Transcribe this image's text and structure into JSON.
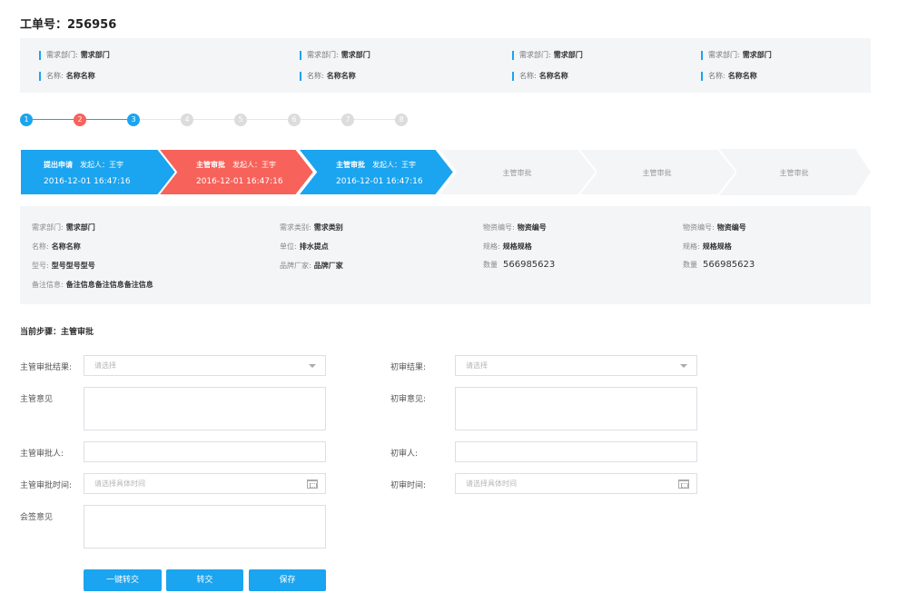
{
  "header": {
    "order_no": "工单号：256956"
  },
  "summary": [
    {
      "label": "需求部门:",
      "value": "需求部门"
    },
    {
      "label": "需求部门:",
      "value": "需求部门"
    },
    {
      "label": "需求部门:",
      "value": "需求部门"
    },
    {
      "label": "需求部门:",
      "value": "需求部门"
    },
    {
      "label": "名称:",
      "value": "名称名称"
    },
    {
      "label": "名称:",
      "value": "名称名称"
    },
    {
      "label": "名称:",
      "value": "名称名称"
    },
    {
      "label": "名称:",
      "value": "名称名称"
    }
  ],
  "stepper": {
    "steps": [
      {
        "label": "1",
        "state": "done"
      },
      {
        "label": "2",
        "state": "rejected"
      },
      {
        "label": "3",
        "state": "current"
      },
      {
        "label": "4",
        "state": "pending"
      },
      {
        "label": "5",
        "state": "pending"
      },
      {
        "label": "6",
        "state": "pending"
      },
      {
        "label": "7",
        "state": "pending"
      },
      {
        "label": "8",
        "state": "pending"
      }
    ],
    "colors": {
      "done": "#1ba4ef",
      "rejected": "#f7625b",
      "pending": "#dcdcdc"
    }
  },
  "flow": [
    {
      "title": "提出申请",
      "starter": "发起人：王宇",
      "time": "2016-12-01 16:47:16",
      "state": "done",
      "color": "#1ba4ef"
    },
    {
      "title": "主管审批",
      "starter": "发起人：王宇",
      "time": "2016-12-01 16:47:16",
      "state": "rejected",
      "color": "#f7625b"
    },
    {
      "title": "主管审批",
      "starter": "发起人：王宇",
      "time": "2016-12-01 16:47:16",
      "state": "current",
      "color": "#1ba4ef"
    },
    {
      "title": "主管审批",
      "state": "pending",
      "color": "#f4f5f7"
    },
    {
      "title": "主管审批",
      "state": "pending",
      "color": "#f4f5f7"
    },
    {
      "title": "主管审批",
      "state": "pending",
      "color": "#f4f5f7"
    }
  ],
  "details": {
    "r1": [
      {
        "label": "需求部门:",
        "value": "需求部门"
      },
      {
        "label": "需求类别:",
        "value": "需求类别"
      },
      {
        "label": "物资编号:",
        "value": "物资编号"
      },
      {
        "label": "物资编号:",
        "value": "物资编号"
      }
    ],
    "r2": [
      {
        "label": "名称:",
        "value": "名称名称"
      },
      {
        "label": "单位:",
        "value": "排水提点"
      },
      {
        "label": "规格:",
        "value": "规格规格"
      },
      {
        "label": "规格:",
        "value": "规格规格"
      }
    ],
    "r3": [
      {
        "label": "型号:",
        "value": "型号型号型号"
      },
      {
        "label": "品牌厂家:",
        "value": "品牌厂家"
      },
      {
        "label": "数量",
        "value": "566985623"
      },
      {
        "label": "数量",
        "value": "566985623"
      }
    ],
    "note": {
      "label": "备注信息:",
      "value": "备注信息备注信息备注信息"
    }
  },
  "current_step": "当前步骤：主管审批",
  "form": {
    "left": {
      "result_label": "主管审批结果:",
      "result_placeholder": "请选择",
      "opinion_label": "主管意见",
      "approver_label": "主管审批人:",
      "time_label": "主管审批时间:",
      "time_placeholder": "请选择具体时间",
      "countersign_label": "会签意见"
    },
    "right": {
      "result_label": "初审结果:",
      "result_placeholder": "请选择",
      "opinion_label": "初审意见:",
      "approver_label": "初审人:",
      "time_label": "初审时间:",
      "time_placeholder": "请选择具体时间"
    }
  },
  "buttons": {
    "transfer_one": "一键转交",
    "transfer": "转交",
    "save": "保存"
  },
  "accent_color": "#1ba4ef"
}
